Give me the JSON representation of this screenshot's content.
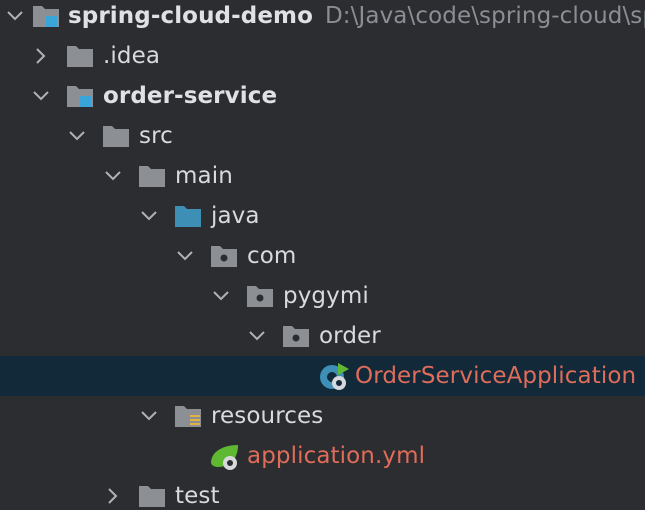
{
  "project_tree": {
    "root": {
      "name": "spring-cloud-demo",
      "path": "D:\\Java\\code\\spring-cloud\\sp"
    },
    "items": [
      {
        "label": ".idea"
      },
      {
        "label": "order-service"
      },
      {
        "label": "src"
      },
      {
        "label": "main"
      },
      {
        "label": "java"
      },
      {
        "label": "com"
      },
      {
        "label": "pygymi"
      },
      {
        "label": "order"
      },
      {
        "label": "OrderServiceApplication"
      },
      {
        "label": "resources"
      },
      {
        "label": "application.yml"
      },
      {
        "label": "test"
      }
    ],
    "selected_item": "OrderServiceApplication"
  },
  "colors": {
    "background": "#2b2d30",
    "selection": "#12293a",
    "text": "#d7dadf",
    "muted_path": "#8b8e94",
    "error_red": "#e06c5a",
    "folder_gray": "#8c9095",
    "source_blue": "#3d8fb5",
    "module_blue": "#3aa5d8",
    "spring_green": "#5fb832"
  },
  "icons": {
    "expanded": "chevron-down-icon",
    "collapsed": "chevron-right-icon",
    "module": "module-folder-icon",
    "folder": "folder-icon",
    "source_root": "source-folder-icon",
    "package": "package-icon",
    "resources": "resources-folder-icon",
    "spring_class": "spring-boot-class-icon",
    "spring_config": "spring-config-icon"
  }
}
